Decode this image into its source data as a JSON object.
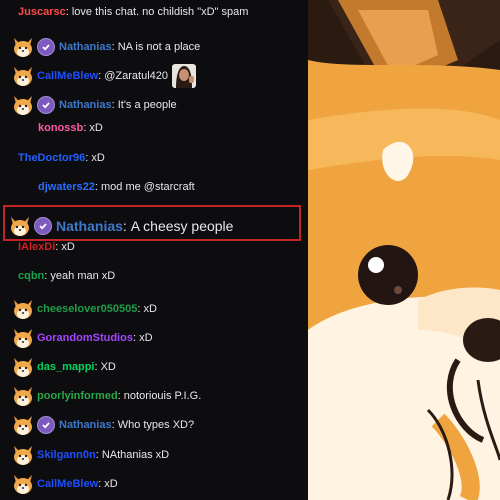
{
  "colors": {
    "chat_bg": "#0d0d10",
    "highlight_border": "#c52424",
    "badge_purple": "#7d5bbe",
    "text": "#e8e8ea"
  },
  "messages": [
    {
      "user": "Juscarsc",
      "color": "#ff4b4b",
      "text": "love this chat. no childish \"xD\" spam",
      "shiba": false,
      "check": false,
      "emote": false
    },
    {
      "user": "Nathanias",
      "color": "#3f78c8",
      "text": "NA is not a place",
      "shiba": true,
      "check": true,
      "emote": false
    },
    {
      "user": "CallMeBlew",
      "color": "#1e4fff",
      "text": "@Zaratul420",
      "shiba": true,
      "check": false,
      "emote": true
    },
    {
      "user": "Nathanias",
      "color": "#3f78c8",
      "text": "It's a people",
      "shiba": true,
      "check": true,
      "emote": false
    },
    {
      "user": "konossb",
      "color": "#ff5aa8",
      "text": "xD",
      "shiba": false,
      "check": false,
      "emote": false
    },
    {
      "user": "TheDoctor96",
      "color": "#2060ff",
      "text": "xD",
      "shiba": false,
      "check": false,
      "emote": false
    },
    {
      "user": "djwaters22",
      "color": "#2a6cff",
      "text": "mod me @starcraft",
      "shiba": false,
      "check": false,
      "emote": false
    },
    {
      "user": "IAlexDi",
      "color": "#d41f1f",
      "text": "xD",
      "shiba": false,
      "check": false,
      "emote": false
    },
    {
      "user": "cqbn",
      "color": "#1aa34a",
      "text": "yeah man xD",
      "shiba": false,
      "check": false,
      "emote": false
    },
    {
      "user": "cheeselover050505",
      "color": "#1f9d4a",
      "text": "xD",
      "shiba": true,
      "check": false,
      "emote": false
    },
    {
      "user": "GorandomStudios",
      "color": "#a445ff",
      "text": "xD",
      "shiba": true,
      "check": false,
      "emote": false
    },
    {
      "user": "das_mappi",
      "color": "#00d45f",
      "text": "XD",
      "shiba": true,
      "check": false,
      "emote": false
    },
    {
      "user": "poorlyinformed",
      "color": "#2aa84a",
      "text": "notoriouis P.I.G.",
      "shiba": true,
      "check": false,
      "emote": false
    },
    {
      "user": "Nathanias",
      "color": "#3f78c8",
      "text": "Who types XD?",
      "shiba": true,
      "check": true,
      "emote": false
    },
    {
      "user": "Skilgann0n",
      "color": "#1e4fff",
      "text": "NAthanias xD",
      "shiba": true,
      "check": false,
      "emote": false
    },
    {
      "user": "CallMeBlew",
      "color": "#1e4fff",
      "text": "xD",
      "shiba": true,
      "check": false,
      "emote": false
    }
  ],
  "highlight": {
    "user": "Nathanias",
    "color": "#3f78c8",
    "text": "A cheesy people"
  }
}
